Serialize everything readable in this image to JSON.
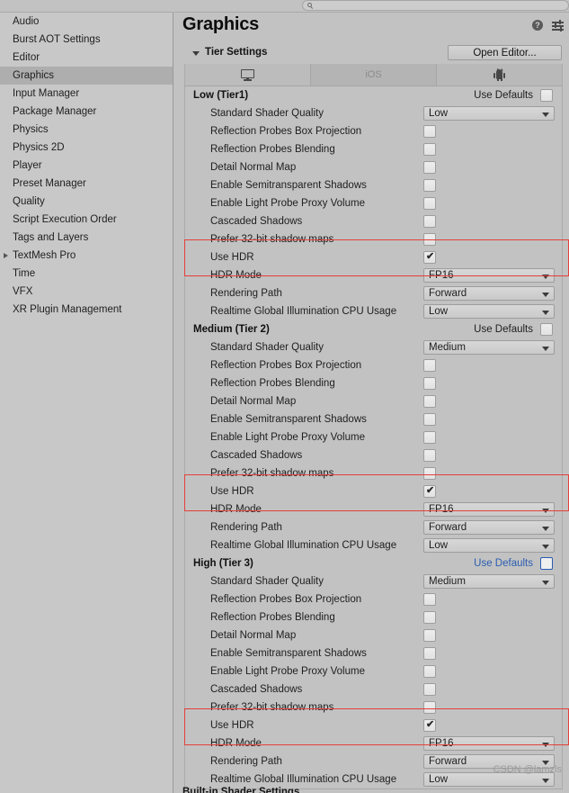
{
  "window": {
    "search_placeholder": "",
    "search_value": ""
  },
  "sidebar": {
    "items": [
      {
        "label": "Audio",
        "selected": false,
        "expandable": false
      },
      {
        "label": "Burst AOT Settings",
        "selected": false,
        "expandable": false
      },
      {
        "label": "Editor",
        "selected": false,
        "expandable": false
      },
      {
        "label": "Graphics",
        "selected": true,
        "expandable": false
      },
      {
        "label": "Input Manager",
        "selected": false,
        "expandable": false
      },
      {
        "label": "Package Manager",
        "selected": false,
        "expandable": false
      },
      {
        "label": "Physics",
        "selected": false,
        "expandable": false
      },
      {
        "label": "Physics 2D",
        "selected": false,
        "expandable": false
      },
      {
        "label": "Player",
        "selected": false,
        "expandable": false
      },
      {
        "label": "Preset Manager",
        "selected": false,
        "expandable": false
      },
      {
        "label": "Quality",
        "selected": false,
        "expandable": false
      },
      {
        "label": "Script Execution Order",
        "selected": false,
        "expandable": false
      },
      {
        "label": "Tags and Layers",
        "selected": false,
        "expandable": false
      },
      {
        "label": "TextMesh Pro",
        "selected": false,
        "expandable": true
      },
      {
        "label": "Time",
        "selected": false,
        "expandable": false
      },
      {
        "label": "VFX",
        "selected": false,
        "expandable": false
      },
      {
        "label": "XR Plugin Management",
        "selected": false,
        "expandable": false
      }
    ]
  },
  "header": {
    "title": "Graphics",
    "help_icon": "help-icon",
    "preset_icon": "preset-settings-icon"
  },
  "foldout": {
    "title": "Tier Settings",
    "open_editor_label": "Open Editor..."
  },
  "platform_tabs": [
    {
      "label": "",
      "icon": "desktop-monitor-icon",
      "active": true
    },
    {
      "label": "iOS",
      "icon": "",
      "active": false
    },
    {
      "label": "",
      "icon": "android-robot-icon",
      "active": false
    }
  ],
  "common": {
    "use_defaults_label": "Use Defaults",
    "checked_mark": "✔"
  },
  "tiers": [
    {
      "name": "Low (Tier1)",
      "use_defaults_label": "Use Defaults",
      "use_defaults_checked": false,
      "use_defaults_focused": false,
      "rows": [
        {
          "label": "Standard Shader Quality",
          "type": "dropdown",
          "value": "Low"
        },
        {
          "label": "Reflection Probes Box Projection",
          "type": "checkbox",
          "checked": false
        },
        {
          "label": "Reflection Probes Blending",
          "type": "checkbox",
          "checked": false
        },
        {
          "label": "Detail Normal Map",
          "type": "checkbox",
          "checked": false
        },
        {
          "label": "Enable Semitransparent Shadows",
          "type": "checkbox",
          "checked": false
        },
        {
          "label": "Enable Light Probe Proxy Volume",
          "type": "checkbox",
          "checked": false
        },
        {
          "label": "Cascaded Shadows",
          "type": "checkbox",
          "checked": false
        },
        {
          "label": "Prefer 32-bit shadow maps",
          "type": "checkbox",
          "checked": false
        },
        {
          "label": "Use HDR",
          "type": "checkbox",
          "checked": true,
          "highlighted": true
        },
        {
          "label": "HDR Mode",
          "type": "dropdown",
          "value": "FP16",
          "highlighted": true
        },
        {
          "label": "Rendering Path",
          "type": "dropdown",
          "value": "Forward"
        },
        {
          "label": "Realtime Global Illumination CPU Usage",
          "type": "dropdown",
          "value": "Low"
        }
      ]
    },
    {
      "name": "Medium (Tier 2)",
      "use_defaults_label": "Use Defaults",
      "use_defaults_checked": false,
      "use_defaults_focused": false,
      "rows": [
        {
          "label": "Standard Shader Quality",
          "type": "dropdown",
          "value": "Medium"
        },
        {
          "label": "Reflection Probes Box Projection",
          "type": "checkbox",
          "checked": false
        },
        {
          "label": "Reflection Probes Blending",
          "type": "checkbox",
          "checked": false
        },
        {
          "label": "Detail Normal Map",
          "type": "checkbox",
          "checked": false
        },
        {
          "label": "Enable Semitransparent Shadows",
          "type": "checkbox",
          "checked": false
        },
        {
          "label": "Enable Light Probe Proxy Volume",
          "type": "checkbox",
          "checked": false
        },
        {
          "label": "Cascaded Shadows",
          "type": "checkbox",
          "checked": false
        },
        {
          "label": "Prefer 32-bit shadow maps",
          "type": "checkbox",
          "checked": false
        },
        {
          "label": "Use HDR",
          "type": "checkbox",
          "checked": true,
          "highlighted": true
        },
        {
          "label": "HDR Mode",
          "type": "dropdown",
          "value": "FP16",
          "highlighted": true
        },
        {
          "label": "Rendering Path",
          "type": "dropdown",
          "value": "Forward"
        },
        {
          "label": "Realtime Global Illumination CPU Usage",
          "type": "dropdown",
          "value": "Low"
        }
      ]
    },
    {
      "name": "High (Tier 3)",
      "use_defaults_label": "Use Defaults",
      "use_defaults_checked": false,
      "use_defaults_focused": true,
      "rows": [
        {
          "label": "Standard Shader Quality",
          "type": "dropdown",
          "value": "Medium"
        },
        {
          "label": "Reflection Probes Box Projection",
          "type": "checkbox",
          "checked": false
        },
        {
          "label": "Reflection Probes Blending",
          "type": "checkbox",
          "checked": false
        },
        {
          "label": "Detail Normal Map",
          "type": "checkbox",
          "checked": false
        },
        {
          "label": "Enable Semitransparent Shadows",
          "type": "checkbox",
          "checked": false
        },
        {
          "label": "Enable Light Probe Proxy Volume",
          "type": "checkbox",
          "checked": false
        },
        {
          "label": "Cascaded Shadows",
          "type": "checkbox",
          "checked": false
        },
        {
          "label": "Prefer 32-bit shadow maps",
          "type": "checkbox",
          "checked": false
        },
        {
          "label": "Use HDR",
          "type": "checkbox",
          "checked": true,
          "highlighted": true
        },
        {
          "label": "HDR Mode",
          "type": "dropdown",
          "value": "FP16",
          "highlighted": true
        },
        {
          "label": "Rendering Path",
          "type": "dropdown",
          "value": "Forward"
        },
        {
          "label": "Realtime Global Illumination CPU Usage",
          "type": "dropdown",
          "value": "Low"
        }
      ]
    }
  ],
  "next_section_label": "Built-in Shader Settings",
  "watermark": "CSDN @lamzls",
  "colors": {
    "accent_blue": "#2a5db0",
    "annotation_red": "#e2403a",
    "panel_bg": "#c2c2c2",
    "sidebar_bg": "#c8c8c8",
    "selected_row": "#aeaeae"
  }
}
